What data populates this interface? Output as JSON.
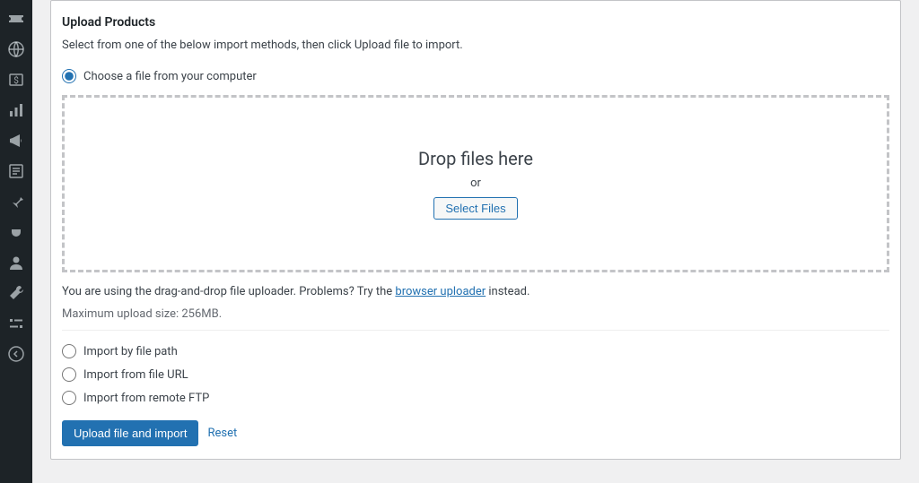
{
  "sidebar": {
    "items": [
      {
        "name": "tickets-icon"
      },
      {
        "name": "globe-icon"
      },
      {
        "name": "money-icon"
      },
      {
        "name": "stats-icon"
      },
      {
        "name": "megaphone-icon"
      },
      {
        "name": "form-icon"
      },
      {
        "name": "pin-icon"
      },
      {
        "name": "plug-icon"
      },
      {
        "name": "user-icon"
      },
      {
        "name": "tools-icon"
      },
      {
        "name": "settings-icon"
      },
      {
        "name": "collapse-icon"
      }
    ]
  },
  "panel": {
    "title": "Upload Products",
    "description": "Select from one of the below import methods, then click Upload file to import."
  },
  "upload": {
    "choose_file_label": "Choose a file from your computer",
    "drop_title": "Drop files here",
    "or_text": "or",
    "select_files_label": "Select Files",
    "helper_prefix": "You are using the drag-and-drop file uploader. Problems? Try the ",
    "helper_link": "browser uploader",
    "helper_suffix": " instead.",
    "max_size": "Maximum upload size: 256MB."
  },
  "options": {
    "by_path": "Import by file path",
    "by_url": "Import from file URL",
    "by_ftp": "Import from remote FTP"
  },
  "actions": {
    "upload_label": "Upload file and import",
    "reset_label": "Reset"
  }
}
